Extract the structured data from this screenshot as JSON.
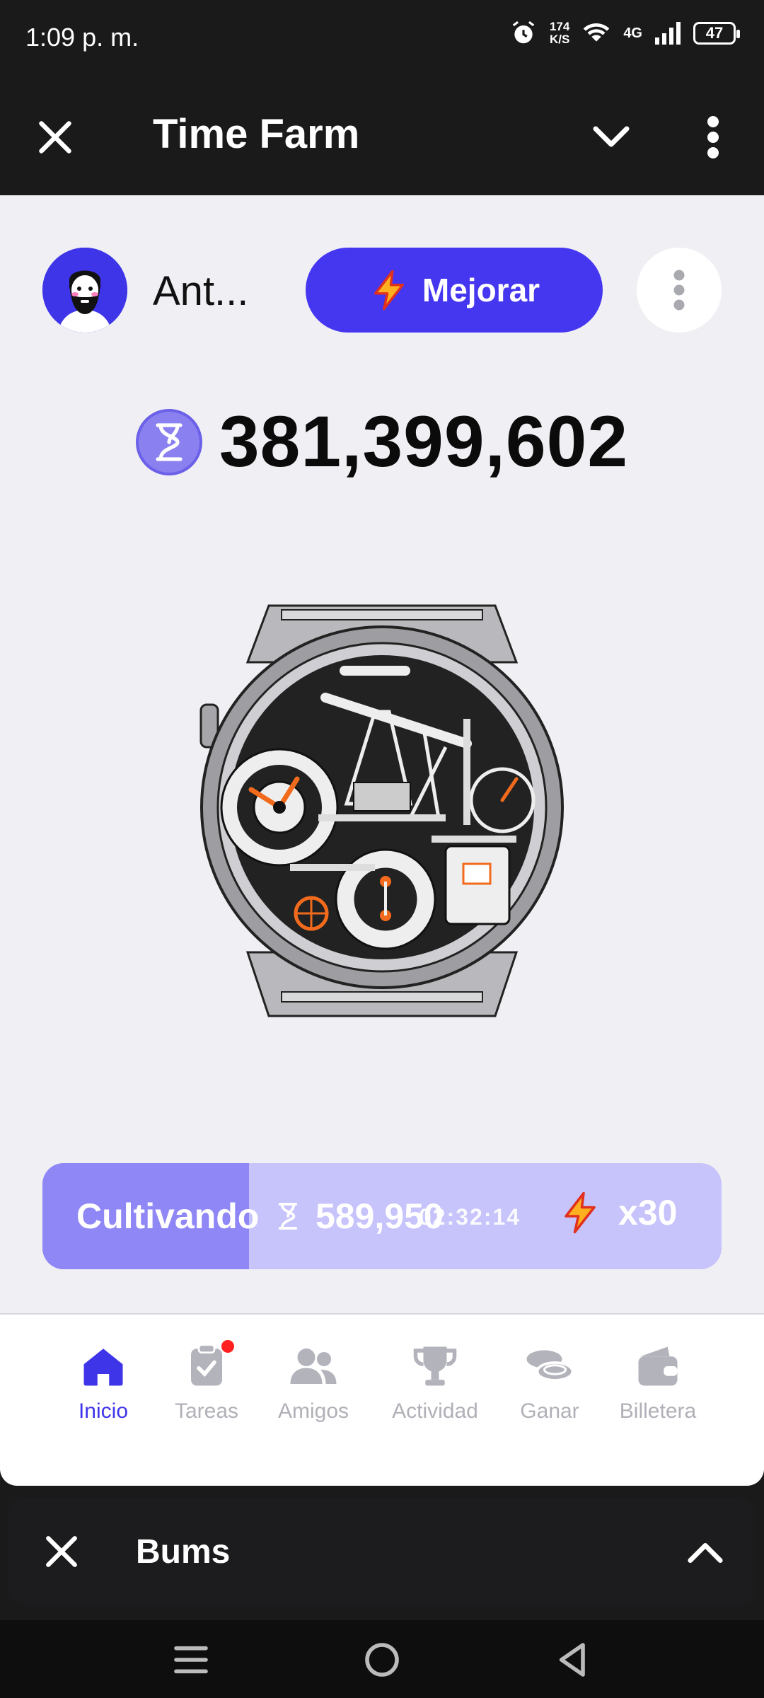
{
  "status_bar": {
    "time": "1:09 p. m.",
    "speed_value": "174",
    "speed_unit": "K/S",
    "network": "4G",
    "battery": "47"
  },
  "header": {
    "title": "Time Farm",
    "icons": [
      "close-icon",
      "chevron-down-icon",
      "more-vertical-icon"
    ]
  },
  "profile": {
    "username": "Ant...",
    "upgrade_label": "Mejorar"
  },
  "balance": {
    "value": "381,399,602"
  },
  "farming": {
    "label": "Cultivando",
    "amount": "589,950",
    "timer": "02:32:14",
    "multiplier": "x30",
    "progress": 0.304
  },
  "nav": {
    "items": [
      {
        "label": "Inicio",
        "icon": "home-icon",
        "active": true
      },
      {
        "label": "Tareas",
        "icon": "clipboard-check-icon",
        "badge": true
      },
      {
        "label": "Amigos",
        "icon": "users-icon"
      },
      {
        "label": "Actividad",
        "icon": "trophy-icon"
      },
      {
        "label": "Ganar",
        "icon": "coins-icon"
      },
      {
        "label": "Billetera",
        "icon": "wallet-icon"
      }
    ]
  },
  "mini_app": {
    "title": "Bums"
  },
  "colors": {
    "accent": "#4536f0",
    "progress_fill": "#8f87f6",
    "progress_track": "#c7c3fb",
    "background": "#efeff4"
  }
}
